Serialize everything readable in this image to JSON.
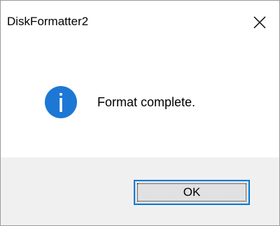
{
  "window": {
    "title": "DiskFormatter2",
    "close_icon": "close-icon"
  },
  "message": {
    "icon": "info-icon",
    "text": "Format complete."
  },
  "buttons": {
    "ok_label": "OK"
  },
  "colors": {
    "info_icon": "#1c78d4",
    "focus_border": "#0078d7",
    "button_face": "#e1e1e1",
    "footer_bg": "#f0f0f0"
  }
}
